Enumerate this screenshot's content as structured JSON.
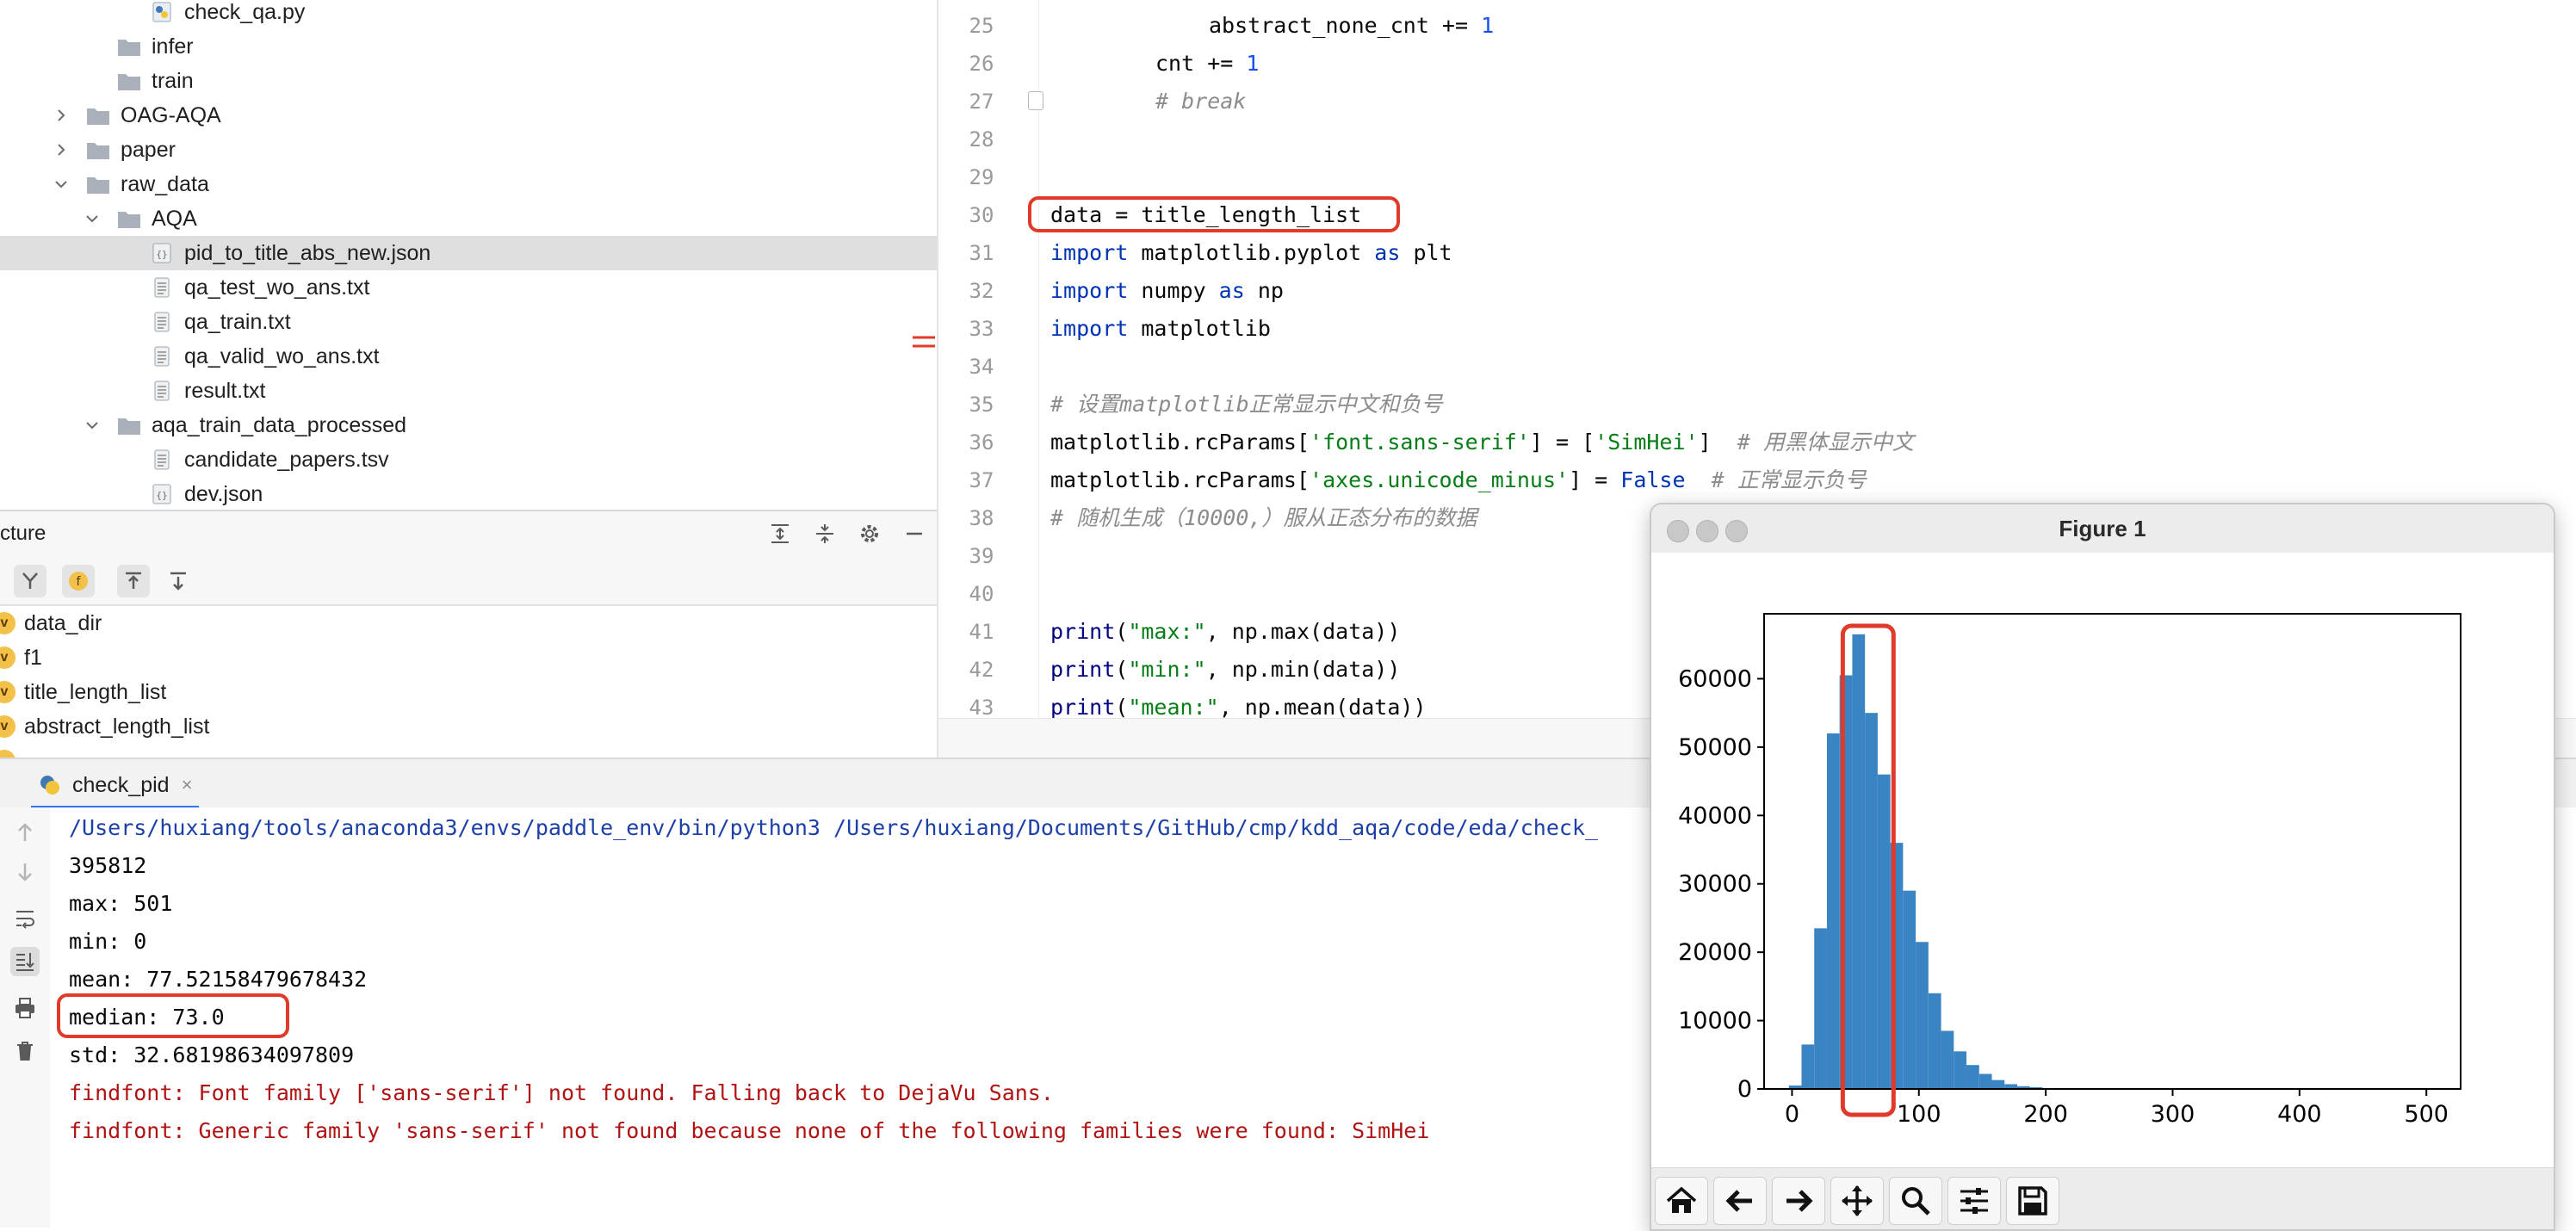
{
  "project_tree": {
    "items": [
      {
        "label": "check_qa.py",
        "type": "python"
      },
      {
        "label": "infer",
        "type": "folder"
      },
      {
        "label": "train",
        "type": "folder"
      },
      {
        "label": "OAG-AQA",
        "type": "folder"
      },
      {
        "label": "paper",
        "type": "folder"
      },
      {
        "label": "raw_data",
        "type": "folder"
      },
      {
        "label": "AQA",
        "type": "folder"
      },
      {
        "label": "pid_to_title_abs_new.json",
        "type": "json"
      },
      {
        "label": "qa_test_wo_ans.txt",
        "type": "text"
      },
      {
        "label": "qa_train.txt",
        "type": "text"
      },
      {
        "label": "qa_valid_wo_ans.txt",
        "type": "text"
      },
      {
        "label": "result.txt",
        "type": "text"
      },
      {
        "label": "aqa_train_data_processed",
        "type": "folder"
      },
      {
        "label": "candidate_papers.tsv",
        "type": "text"
      },
      {
        "label": "dev.json",
        "type": "json"
      }
    ]
  },
  "structure": {
    "title": "cture",
    "variables": [
      "data_dir",
      "f1",
      "title_length_list",
      "abstract_length_list"
    ],
    "badge_letter": "v",
    "f_badge": "f"
  },
  "editor": {
    "lines": [
      {
        "n": "25",
        "text": "abstract_none_cnt += 1"
      },
      {
        "n": "26",
        "text": "cnt += 1"
      },
      {
        "n": "27",
        "text": "# break"
      },
      {
        "n": "28",
        "text": ""
      },
      {
        "n": "29",
        "text": ""
      },
      {
        "n": "30",
        "text": "data = title_length_list"
      },
      {
        "n": "31",
        "text": "import matplotlib.pyplot as plt"
      },
      {
        "n": "32",
        "text": "import numpy as np"
      },
      {
        "n": "33",
        "text": "import matplotlib"
      },
      {
        "n": "34",
        "text": ""
      },
      {
        "n": "35",
        "text": "# 设置matplotlib正常显示中文和负号"
      },
      {
        "n": "36",
        "text": "matplotlib.rcParams['font.sans-serif'] = ['SimHei']  # 用黑体显示中文"
      },
      {
        "n": "37",
        "text": "matplotlib.rcParams['axes.unicode_minus'] = False  # 正常显示负号"
      },
      {
        "n": "38",
        "text": "# 随机生成（10000,）服从正态分布的数据"
      },
      {
        "n": "39",
        "text": ""
      },
      {
        "n": "40",
        "text": ""
      },
      {
        "n": "41",
        "text": "print(\"max:\", np.max(data))"
      },
      {
        "n": "42",
        "text": "print(\"min:\", np.min(data))"
      },
      {
        "n": "43",
        "text": "print(\"mean:\", np.mean(data))"
      }
    ],
    "tok": {
      "l25a": "abstract_none_cnt += ",
      "l25b": "1",
      "l26a": "cnt += ",
      "l26b": "1",
      "l27": "# break",
      "l30": "data = title_length_list",
      "import": "import",
      "as": "as",
      "l31a": " matplotlib.pyplot ",
      "l31b": " plt",
      "l32a": " numpy ",
      "l32b": " np",
      "l33a": " matplotlib",
      "l35a": "# 设置",
      "l35b": "matplotlib",
      "l35c": "正常显示中文和负号",
      "l36a": "matplotlib.rcParams[",
      "l36b": "'font.sans-serif'",
      "l36c": "] = [",
      "l36d": "'SimHei'",
      "l36e": "]  ",
      "l36f": "# 用黑体显示中文",
      "l37a": "matplotlib.rcParams[",
      "l37b": "'axes.unicode_minus'",
      "l37c": "] = ",
      "l37d": "False",
      "l37e": "  ",
      "l37f": "# 正常显示负号",
      "l38a": "# 随机生成（",
      "l38b": "10000,",
      "l38c": "）服从正态分布的数据",
      "print": "print",
      "l41a": "(",
      "l41b": "\"max:\"",
      "l41c": ", np.max(data))",
      "l42a": "(",
      "l42b": "\"min:\"",
      "l42c": ", np.min(data))",
      "l43a": "(",
      "l43b": "\"mean:\"",
      "l43c": ", np.mean(data))"
    }
  },
  "run": {
    "tab_label": "check_pid",
    "tab_close": "×",
    "console": [
      {
        "text": "/Users/huxiang/tools/anaconda3/envs/paddle_env/bin/python3 /Users/huxiang/Documents/GitHub/cmp/kdd_aqa/code/eda/check_",
        "kind": "path"
      },
      {
        "text": "395812",
        "kind": "out"
      },
      {
        "text": "max: 501",
        "kind": "out"
      },
      {
        "text": "min: 0",
        "kind": "out"
      },
      {
        "text": "mean: 77.52158479678432",
        "kind": "out"
      },
      {
        "text": "median: 73.0",
        "kind": "out"
      },
      {
        "text": "std: 32.68198634097809",
        "kind": "out"
      },
      {
        "text": "findfont: Font family ['sans-serif'] not found. Falling back to DejaVu Sans.",
        "kind": "err"
      },
      {
        "text": "findfont: Generic family 'sans-serif' not found because none of the following families were found: SimHei",
        "kind": "err"
      }
    ]
  },
  "figure": {
    "title": "Figure 1",
    "toolbar": [
      "home-icon",
      "back-arrow-icon",
      "forward-arrow-icon",
      "pan-move-icon",
      "zoom-magnifier-icon",
      "configure-subplots-icon",
      "save-disk-icon"
    ]
  },
  "chart_data": {
    "type": "bar",
    "title": "",
    "xlabel": "",
    "ylabel": "",
    "x": [
      2.5,
      12.5,
      22.5,
      32.5,
      42.5,
      52.5,
      62.5,
      72.5,
      82.5,
      92.5,
      102.5,
      112.5,
      122.5,
      132.5,
      142.5,
      152.5,
      162.5,
      172.5,
      182.5,
      192.5,
      202.5,
      212.5,
      222.5
    ],
    "bin_width": 10,
    "values": [
      500,
      6500,
      23500,
      52000,
      60500,
      66500,
      55000,
      46000,
      36000,
      29000,
      21500,
      14000,
      8500,
      5500,
      3500,
      2200,
      1300,
      700,
      400,
      250,
      120,
      60,
      20
    ],
    "xlim": [
      -22,
      527
    ],
    "ylim": [
      0,
      69500
    ],
    "xticks": [
      0,
      100,
      200,
      300,
      400,
      500
    ],
    "yticks": [
      0,
      10000,
      20000,
      30000,
      40000,
      50000,
      60000
    ],
    "bar_color": "#3b84c4",
    "highlight_range": [
      40,
      80
    ]
  },
  "colors": {
    "highlight": "#e03a2a",
    "accent": "#3574f0"
  }
}
